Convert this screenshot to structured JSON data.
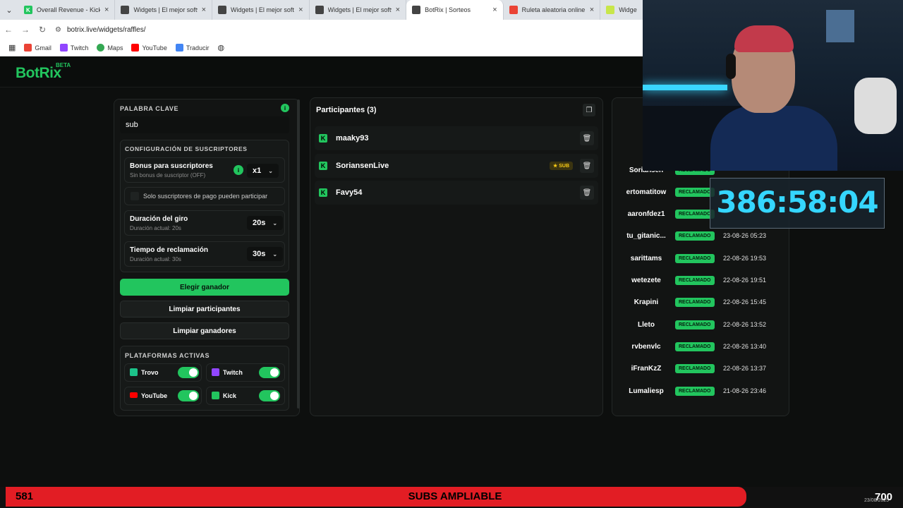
{
  "browser": {
    "tabs": [
      {
        "title": "Overall Revenue - Kick Da",
        "color": "#22c55e"
      },
      {
        "title": "Widgets | El mejor softwa",
        "color": "#444"
      },
      {
        "title": "Widgets | El mejor softwa",
        "color": "#444"
      },
      {
        "title": "Widgets | El mejor softwa",
        "color": "#444"
      },
      {
        "title": "BotRix | Sorteos",
        "color": "#444",
        "active": true
      },
      {
        "title": "Ruleta aleatoria online - ",
        "color": "#ea4335"
      },
      {
        "title": "Widgets",
        "color": "#c8e64a"
      }
    ],
    "url": "botrix.live/widgets/raffles/",
    "bookmarks": [
      "Gmail",
      "Twitch",
      "Maps",
      "YouTube",
      "Traducir"
    ]
  },
  "app": {
    "logo": "BotRix",
    "beta": "BETA"
  },
  "settings": {
    "keyword_label": "PALABRA CLAVE",
    "keyword_value": "sub",
    "subs_config_label": "CONFIGURACIÓN DE SUSCRIPTORES",
    "bonus_title": "Bonus para suscriptores",
    "bonus_sub": "Sin bonus de suscriptor (OFF)",
    "bonus_value": "x1",
    "paid_only_label": "Solo suscriptores de pago pueden participar",
    "spin_title": "Duración del giro",
    "spin_sub": "Duración actual: 20s",
    "spin_value": "20s",
    "claim_title": "Tiempo de reclamación",
    "claim_sub": "Duración actual: 30s",
    "claim_value": "30s",
    "pick_winner": "Elegir ganador",
    "clear_participants": "Limpiar participantes",
    "clear_winners": "Limpiar ganadores",
    "platforms_label": "PLATAFORMAS ACTIVAS",
    "platforms": [
      {
        "name": "Trovo",
        "color": "#1cc38a",
        "enabled": true
      },
      {
        "name": "Twitch",
        "color": "#9146ff",
        "enabled": true
      },
      {
        "name": "YouTube",
        "color": "#ff0000",
        "enabled": true
      },
      {
        "name": "Kick",
        "color": "#22c55e",
        "enabled": true
      }
    ]
  },
  "participants": {
    "title": "Participantes (3)",
    "list": [
      {
        "name": "maaky93",
        "sub": false
      },
      {
        "name": "SoriansenLive",
        "sub": true,
        "badge": "SUB"
      },
      {
        "name": "Favy54",
        "sub": false
      }
    ]
  },
  "winners": {
    "badge": "RECLAMADO",
    "list": [
      {
        "name": "Soriansen",
        "date": ""
      },
      {
        "name": "ertomatitow",
        "date": ""
      },
      {
        "name": "aaronfdez1",
        "date": ""
      },
      {
        "name": "tu_gitanic...",
        "date": "23-08-26 05:23"
      },
      {
        "name": "sarittams",
        "date": "22-08-26 19:53"
      },
      {
        "name": "wetezete",
        "date": "22-08-26 19:51"
      },
      {
        "name": "Krapini",
        "date": "22-08-26 15:45"
      },
      {
        "name": "Lleto",
        "date": "22-08-26 13:52"
      },
      {
        "name": "rvbenvlc",
        "date": "22-08-26 13:40"
      },
      {
        "name": "iFranKzZ",
        "date": "22-08-26 13:37"
      },
      {
        "name": "Lumaliesp",
        "date": "21-08-26 23:46"
      }
    ]
  },
  "overlay": {
    "timer": "386:58:04",
    "bar_left": "581",
    "bar_center": "SUBS AMPLIABLE",
    "bar_right": "700",
    "bar_date": "23/08/2025"
  }
}
